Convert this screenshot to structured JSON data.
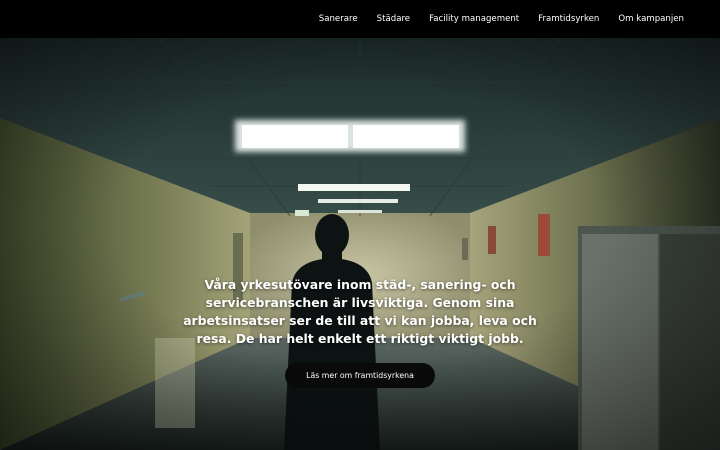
{
  "nav": {
    "items": [
      {
        "label": "Sanerare"
      },
      {
        "label": "Städare"
      },
      {
        "label": "Facility management"
      },
      {
        "label": "Framtidsyrken"
      },
      {
        "label": "Om kampanjen"
      }
    ]
  },
  "hero": {
    "text": "Våra yrkesutövare inom städ-, sanering- och servicebranschen är livsviktiga. Genom sina arbetsinsatser ser de till att vi kan jobba, leva och resa. De har helt enkelt ett riktigt viktigt jobb.",
    "cta_label": "Läs mer om framtidsyrkena"
  },
  "colors": {
    "nav_background": "#000000",
    "nav_text": "#ffffff",
    "button_background": "#0a0a0a"
  }
}
